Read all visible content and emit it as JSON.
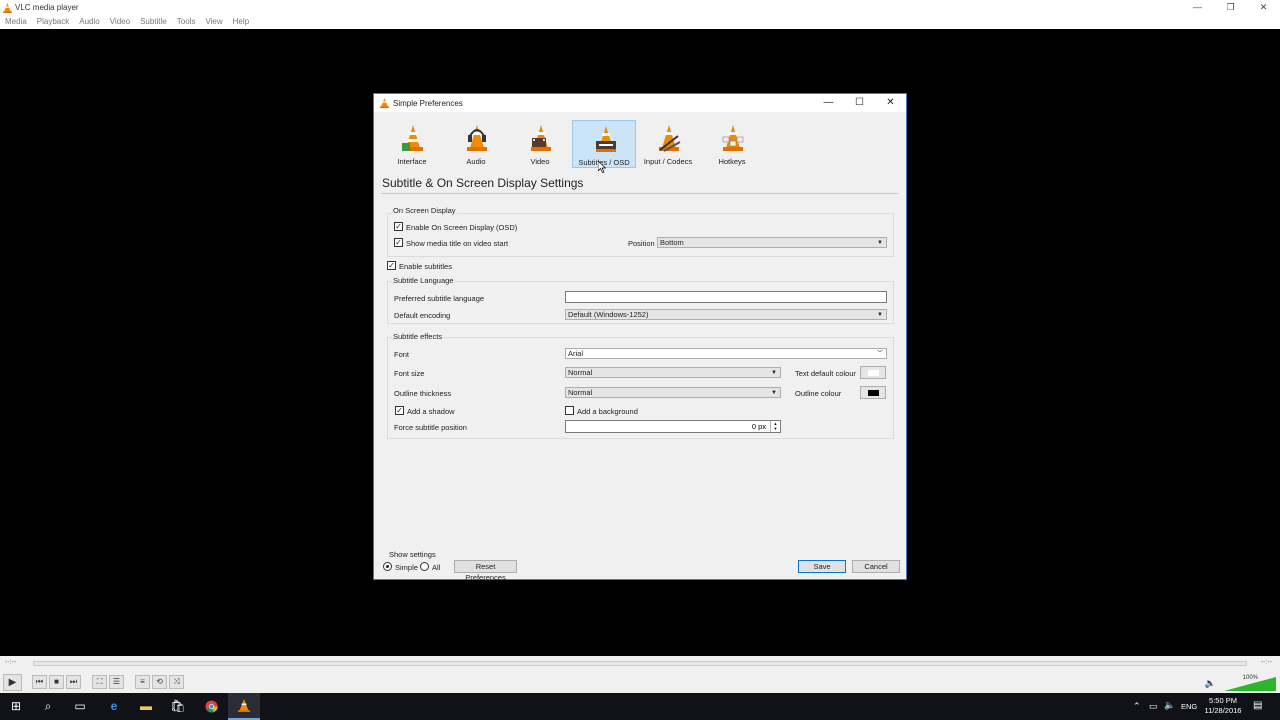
{
  "app": {
    "title": "VLC media player",
    "menu": [
      "Media",
      "Playback",
      "Audio",
      "Video",
      "Subtitle",
      "Tools",
      "View",
      "Help"
    ],
    "window_controls": [
      "—",
      "❐",
      "✕"
    ]
  },
  "dialog": {
    "title": "Simple Preferences",
    "controls": [
      "—",
      "☐",
      "✕"
    ],
    "categories": [
      {
        "label": "Interface",
        "icon": "interface-cone-icon",
        "active": false
      },
      {
        "label": "Audio",
        "icon": "audio-headphones-cone-icon",
        "active": false
      },
      {
        "label": "Video",
        "icon": "video-cone-icon",
        "active": false
      },
      {
        "label": "Subtitles / OSD",
        "icon": "subtitles-cone-icon",
        "active": true
      },
      {
        "label": "Input / Codecs",
        "icon": "input-codecs-cone-icon",
        "active": false
      },
      {
        "label": "Hotkeys",
        "icon": "hotkeys-cone-icon",
        "active": false
      }
    ],
    "heading": "Subtitle & On Screen Display Settings",
    "osd": {
      "group_label": "On Screen Display",
      "enable_osd": {
        "label": "Enable On Screen Display (OSD)",
        "checked": true
      },
      "show_title": {
        "label": "Show media title on video start",
        "checked": true
      },
      "position_label": "Position",
      "position_value": "Bottom"
    },
    "subtitles": {
      "enable": {
        "label": "Enable subtitles",
        "checked": true
      },
      "language_group": "Subtitle Language",
      "preferred_language_label": "Preferred subtitle language",
      "preferred_language_value": "",
      "encoding_label": "Default encoding",
      "encoding_value": "Default (Windows-1252)"
    },
    "effects": {
      "group_label": "Subtitle effects",
      "font_label": "Font",
      "font_value": "Arial",
      "font_size_label": "Font size",
      "font_size_value": "Normal",
      "text_colour_label": "Text default colour",
      "text_colour": "#ffffff",
      "outline_thickness_label": "Outline thickness",
      "outline_thickness_value": "Normal",
      "outline_colour_label": "Outline colour",
      "outline_colour": "#000000",
      "shadow": {
        "label": "Add a shadow",
        "checked": true
      },
      "background": {
        "label": "Add a background",
        "checked": false
      },
      "force_position_label": "Force subtitle position",
      "force_position_value": "0 px"
    },
    "footer": {
      "show_settings_label": "Show settings",
      "simple_label": "Simple",
      "all_label": "All",
      "mode": "Simple",
      "reset_label": "Reset Preferences",
      "save_label": "Save",
      "cancel_label": "Cancel"
    }
  },
  "player": {
    "time_elapsed": "--:--",
    "time_total": "--:--",
    "volume": "100%"
  },
  "taskbar": {
    "language": "ENG",
    "time": "5:50 PM",
    "date": "11/28/2016"
  },
  "colors": {
    "accent": "#0078d7",
    "active_tab_bg": "#cce4f7",
    "volume_green": "#2db52d"
  }
}
